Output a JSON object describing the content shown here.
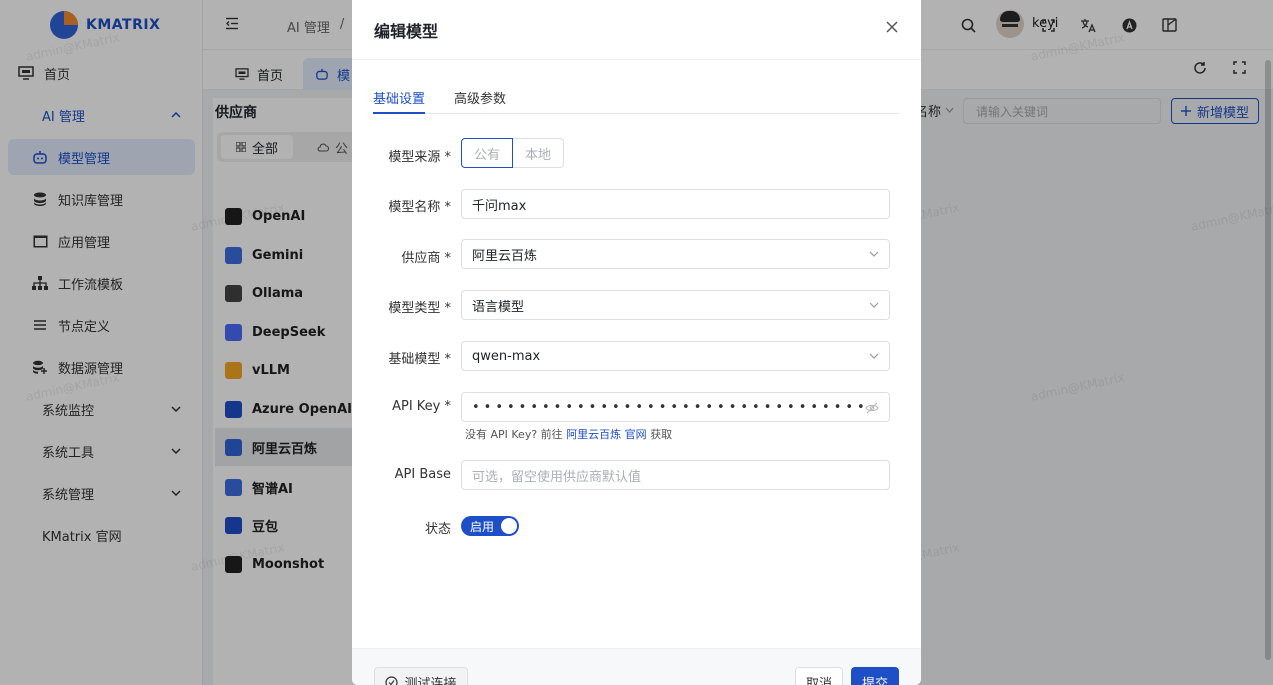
{
  "brand": {
    "name": "KMATRIX"
  },
  "user": {
    "name": "keyi"
  },
  "watermark_text": "admin@KMatrix",
  "breadcrumb": {
    "root": "AI 管理",
    "sep": "/"
  },
  "sidebar": {
    "home": "首页",
    "ai_group": "AI 管理",
    "items": [
      {
        "label": "模型管理",
        "icon": "robot-icon"
      },
      {
        "label": "知识库管理",
        "icon": "database-icon"
      },
      {
        "label": "应用管理",
        "icon": "app-icon"
      },
      {
        "label": "工作流模板",
        "icon": "workflow-icon"
      },
      {
        "label": "节点定义",
        "icon": "menu-icon"
      },
      {
        "label": "数据源管理",
        "icon": "datasource-icon"
      }
    ],
    "groups": [
      "系统监控",
      "系统工具",
      "系统管理"
    ],
    "official": "KMatrix 官网"
  },
  "tabs": {
    "home": "首页",
    "model": "模"
  },
  "vendors": {
    "title": "供应商",
    "all": "全部",
    "public": "公",
    "list": [
      {
        "name": "OpenAI",
        "color": "#222222"
      },
      {
        "name": "Gemini",
        "color": "#3b6fe0"
      },
      {
        "name": "Ollama",
        "color": "#444444"
      },
      {
        "name": "DeepSeek",
        "color": "#4d6bfe"
      },
      {
        "name": "vLLM",
        "color": "#f5a623"
      },
      {
        "name": "Azure OpenAI",
        "color": "#1e4fc7"
      },
      {
        "name": "阿里云百炼",
        "color": "#2f63d8"
      },
      {
        "name": "智谱AI",
        "color": "#3b6fe0"
      },
      {
        "name": "豆包",
        "color": "#1e4fc7"
      },
      {
        "name": "Moonshot",
        "color": "#222222"
      }
    ]
  },
  "toolbar": {
    "name_filter": "名称",
    "search_placeholder": "请输入关键词",
    "new_button": "新增模型"
  },
  "modal": {
    "title": "编辑模型",
    "tabs": [
      "基础设置",
      "高级参数"
    ],
    "fields": {
      "source": {
        "label": "模型来源 *",
        "options": [
          "公有",
          "本地"
        ],
        "selected": "公有"
      },
      "name": {
        "label": "模型名称 *",
        "value": "千问max"
      },
      "vendor": {
        "label": "供应商 *",
        "value": "阿里云百炼"
      },
      "type": {
        "label": "模型类型 *",
        "value": "语言模型"
      },
      "base_model": {
        "label": "基础模型 *",
        "value": "qwen-max"
      },
      "api_key": {
        "label": "API Key *",
        "value": "••••••••••••••••••••••••••••••••••"
      },
      "api_base": {
        "label": "API Base",
        "placeholder": "可选，留空使用供应商默认值"
      },
      "status": {
        "label": "状态",
        "value": "启用",
        "enabled": true
      }
    },
    "hint": {
      "prefix": "没有 API Key? 前往",
      "link": "阿里云百炼 官网",
      "suffix": "获取"
    },
    "footer": {
      "test": "测试连接",
      "cancel": "取消",
      "submit": "提交"
    }
  },
  "colors": {
    "primary": "#1e4fc7",
    "overlay": "rgba(0,0,0,0.3)"
  }
}
